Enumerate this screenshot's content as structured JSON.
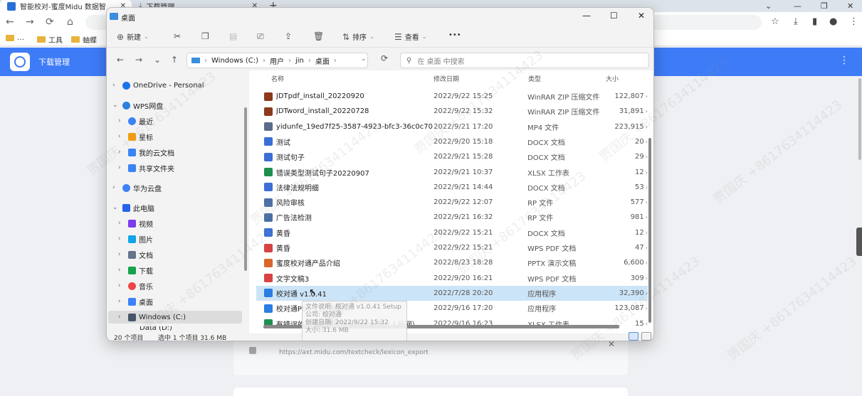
{
  "browser": {
    "tabs": [
      {
        "label": "智能校对-蜜度Midu 数据智",
        "close": "✕"
      },
      {
        "label": "下载管理",
        "close": "✕"
      }
    ],
    "new_tab": "+",
    "bookmarks": [
      {
        "label": "工具"
      },
      {
        "label": "蚰蝶"
      }
    ]
  },
  "app": {
    "title": "下载管理",
    "more_icon": "⋮",
    "download_url": "https://axt.midu.com/textcheck/lexicon_export",
    "card_close": "✕"
  },
  "explorer": {
    "title": "桌面",
    "controls": {
      "minimize": "—",
      "maximize": "☐",
      "close": "✕"
    },
    "commands": {
      "new": "新建",
      "sort": "排序",
      "view": "查看",
      "more": "•••"
    },
    "address": {
      "segments": [
        "Windows (C:)",
        "用户",
        "jin",
        "桌面"
      ],
      "separator": "›",
      "search_placeholder": "在 桌面 中搜索"
    },
    "nav_pane": [
      {
        "label": "OneDrive - Personal",
        "chev": "›",
        "color": "#1a73e8"
      },
      {
        "label": "WPS网盘",
        "chev": "⌄",
        "color": "#2d7fe0"
      },
      {
        "label": "最近",
        "chev": "›",
        "color": "#3b82f6"
      },
      {
        "label": "星标",
        "chev": "›",
        "color": "#f59e0b"
      },
      {
        "label": "我的云文档",
        "chev": "›",
        "color": "#3b82f6"
      },
      {
        "label": "共享文件夹",
        "chev": "›",
        "color": "#3b82f6"
      },
      {
        "label": "华为云盘",
        "chev": "›",
        "color": "#3b82f6"
      },
      {
        "label": "此电脑",
        "chev": "⌄",
        "color": "#2563eb"
      },
      {
        "label": "视频",
        "chev": "›",
        "color": "#7c3aed"
      },
      {
        "label": "图片",
        "chev": "›",
        "color": "#0ea5e9"
      },
      {
        "label": "文档",
        "chev": "›",
        "color": "#64748b"
      },
      {
        "label": "下载",
        "chev": "›",
        "color": "#16a34a"
      },
      {
        "label": "音乐",
        "chev": "›",
        "color": "#ef4444"
      },
      {
        "label": "桌面",
        "chev": "›",
        "color": "#3b82f6"
      },
      {
        "label": "Windows (C:)",
        "chev": "›",
        "color": "#475569"
      }
    ],
    "nav_cut_label": "Data (D:)",
    "columns": {
      "name": "名称",
      "date": "修改日期",
      "type": "类型",
      "size": "大小"
    },
    "files": [
      {
        "name": "JDTpdf_install_20220920",
        "date": "2022/9/22 15:25",
        "type": "WinRAR ZIP 压缩文件",
        "size": "122,807",
        "color": "#8b3a1a"
      },
      {
        "name": "JDTword_install_20220728",
        "date": "2022/9/22 15:32",
        "type": "WinRAR ZIP 压缩文件",
        "size": "31,891",
        "color": "#8b3a1a"
      },
      {
        "name": "yidunfe_19ed7f25-3587-4923-bfc3-36c0c70...",
        "date": "2022/9/21 17:20",
        "type": "MP4 文件",
        "size": "223,915",
        "color": "#5b6b8a"
      },
      {
        "name": "测试",
        "date": "2022/9/20 15:18",
        "type": "DOCX 文档",
        "size": "20",
        "color": "#3b6fd6"
      },
      {
        "name": "测试句子",
        "date": "2022/9/21 15:28",
        "type": "DOCX 文档",
        "size": "29",
        "color": "#3b6fd6"
      },
      {
        "name": "错误类型测试句子20220907",
        "date": "2022/9/21 10:37",
        "type": "XLSX 工作表",
        "size": "12",
        "color": "#1f8f4e"
      },
      {
        "name": "法律法规明细",
        "date": "2022/9/21 14:44",
        "type": "DOCX 文档",
        "size": "53",
        "color": "#3b6fd6"
      },
      {
        "name": "风险审核",
        "date": "2022/9/22 12:07",
        "type": "RP 文件",
        "size": "577",
        "color": "#4a6fa5"
      },
      {
        "name": "广告法检测",
        "date": "2022/9/21 16:32",
        "type": "RP 文件",
        "size": "981",
        "color": "#4a6fa5"
      },
      {
        "name": "黄昏",
        "date": "2022/9/22 15:21",
        "type": "DOCX 文档",
        "size": "12",
        "color": "#3b6fd6"
      },
      {
        "name": "黄昏",
        "date": "2022/9/22 15:21",
        "type": "WPS PDF 文档",
        "size": "47",
        "color": "#d94242"
      },
      {
        "name": "蜜度校对通产品介绍",
        "date": "2022/8/23 18:28",
        "type": "PPTX 演示文稿",
        "size": "6,600",
        "color": "#d9662a"
      },
      {
        "name": "文字文稿3",
        "date": "2022/9/20 16:21",
        "type": "WPS PDF 文档",
        "size": "309",
        "color": "#d94242"
      },
      {
        "name": "校对通 v1.0.41",
        "date": "2022/7/28 20:20",
        "type": "应用程序",
        "size": "32,390",
        "color": "#2a7de1"
      },
      {
        "name": "校对通PDF v1.0.31",
        "date": "2022/9/16 17:20",
        "type": "应用程序",
        "size": "123,087",
        "color": "#2a7de1"
      },
      {
        "name": "有错误的英文文章样例20220905（人民网）",
        "date": "2022/9/16 16:23",
        "type": "XLSX 工作表",
        "size": "15",
        "color": "#1f8f4e"
      }
    ],
    "selected_index": 13,
    "tooltip": {
      "line1": "文件说明: 校对通 v1.0.41 Setup",
      "line2": "公司: 校对通",
      "line3": "创建日期: 2022/9/22 15:32",
      "line4": "大小: 31.6 MB"
    },
    "status": {
      "count": "20 个项目",
      "selection": "选中 1 个项目  31.6 MB"
    }
  },
  "watermark": "贾国庆 +8617634114423"
}
